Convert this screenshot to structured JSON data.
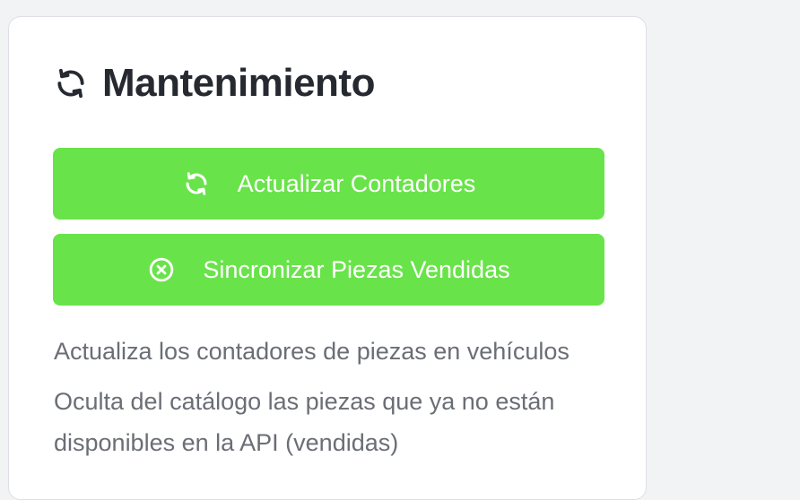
{
  "card": {
    "title": "Mantenimiento",
    "title_icon": "refresh-icon"
  },
  "buttons": [
    {
      "label": "Actualizar Contadores",
      "icon": "refresh-icon"
    },
    {
      "label": "Sincronizar Piezas Vendidas",
      "icon": "circle-x-icon"
    }
  ],
  "descriptions": [
    "Actualiza los contadores de piezas en vehículos",
    "Oculta del catálogo las piezas que ya no están disponibles en la API (vendidas)"
  ],
  "colors": {
    "button_bg": "#69e34a",
    "button_text": "#ffffff",
    "title_text": "#262a30",
    "description_text": "#6a6e75",
    "card_bg": "#ffffff",
    "page_bg": "#f2f3f5"
  }
}
